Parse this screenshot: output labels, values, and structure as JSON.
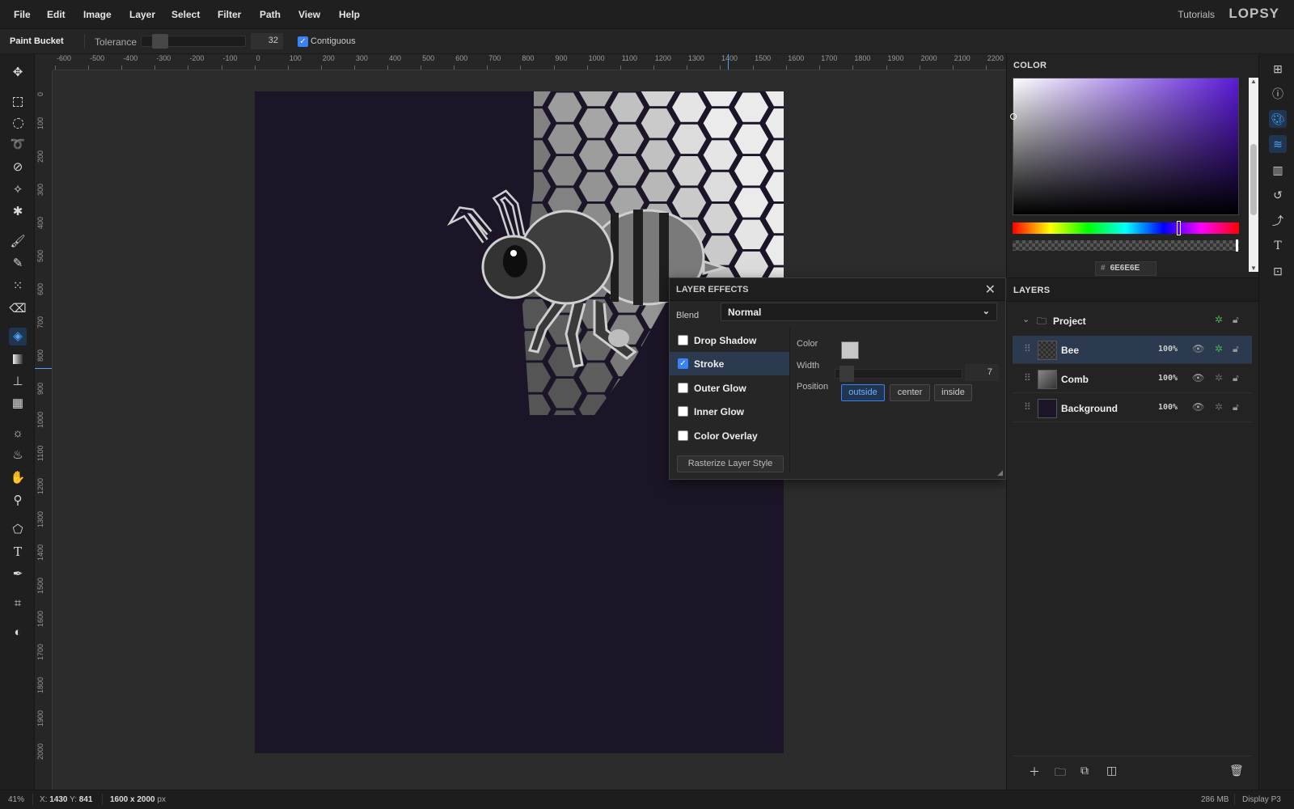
{
  "menubar": {
    "items": [
      "File",
      "Edit",
      "Image",
      "Layer",
      "Select",
      "Filter",
      "Path",
      "View",
      "Help"
    ],
    "tutorials": "Tutorials",
    "logo": "LOPSY"
  },
  "options": {
    "tool_name": "Paint Bucket",
    "tolerance_label": "Tolerance",
    "tolerance_value": "32",
    "contiguous_label": "Contiguous",
    "contiguous_checked": true
  },
  "tools": [
    "move-icon",
    "rect-select-icon",
    "ellipse-select-icon",
    "lasso-icon",
    "quick-select-icon",
    "magic-wand-icon",
    "object-select-icon",
    "brush-icon",
    "pencil-icon",
    "spray-icon",
    "eraser-icon",
    "paint-bucket-icon",
    "gradient-icon",
    "clone-stamp-icon",
    "pattern-icon",
    "dodge-icon",
    "burn-icon",
    "hand-icon",
    "eyedropper-icon",
    "polygon-icon",
    "text-icon",
    "pen-icon",
    "crop-icon",
    "contrast-icon"
  ],
  "active_tool": "paint-bucket-icon",
  "ruler": {
    "h_ticks": [
      "-600",
      "-500",
      "-400",
      "-300",
      "-200",
      "-100",
      "0",
      "100",
      "200",
      "300",
      "400",
      "500",
      "600",
      "700",
      "800",
      "900",
      "1000",
      "1100",
      "1200",
      "1300",
      "1400",
      "1500",
      "1600",
      "1700",
      "1800",
      "1900",
      "2000",
      "2100",
      "2200"
    ],
    "v_ticks": [
      "0",
      "100",
      "200",
      "300",
      "400",
      "500",
      "600",
      "700",
      "800",
      "900",
      "1000",
      "1100",
      "1200",
      "1300",
      "1400",
      "1500",
      "1600",
      "1700",
      "1800",
      "1900",
      "2000"
    ]
  },
  "color_panel": {
    "title": "COLOR",
    "hex_prefix": "#",
    "hex_value": "6E6E6E",
    "hue_color": "#5b1ad8"
  },
  "layer_effects": {
    "title": "LAYER EFFECTS",
    "blend_label": "Blend",
    "blend_value": "Normal",
    "effects": [
      {
        "label": "Drop Shadow",
        "checked": false
      },
      {
        "label": "Stroke",
        "checked": true
      },
      {
        "label": "Outer Glow",
        "checked": false
      },
      {
        "label": "Inner Glow",
        "checked": false
      },
      {
        "label": "Color Overlay",
        "checked": false
      }
    ],
    "rasterize_label": "Rasterize Layer Style",
    "stroke": {
      "color_label": "Color",
      "color": "#c8c8c8",
      "width_label": "Width",
      "width_value": "7",
      "position_label": "Position",
      "positions": [
        "outside",
        "center",
        "inside"
      ],
      "selected_position": "outside"
    }
  },
  "layers": {
    "title": "LAYERS",
    "group": "Project",
    "items": [
      {
        "name": "Bee",
        "opacity": "100%",
        "selected": true
      },
      {
        "name": "Comb",
        "opacity": "100%",
        "selected": false
      },
      {
        "name": "Background",
        "opacity": "100%",
        "selected": false
      }
    ]
  },
  "statusbar": {
    "zoom": "41%",
    "x_label": "X:",
    "x_value": "1430",
    "y_label": "Y:",
    "y_value": "841",
    "doc_size": "1600 x 2000",
    "doc_unit": "px",
    "memory": "286 MB",
    "color_profile": "Display P3"
  },
  "colors": {
    "accent": "#3b82f6",
    "canvas_bg": "#1c1527",
    "panel_bg": "#232323"
  }
}
